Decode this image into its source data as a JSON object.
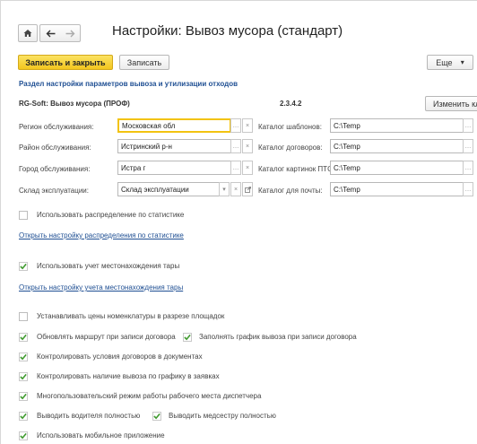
{
  "header": {
    "title": "Настройки: Вывоз мусора (стандарт)"
  },
  "icons": {
    "home": "home-icon",
    "back": "arrow-left-icon",
    "forward": "arrow-right-icon",
    "clear": "×",
    "select": "…",
    "dropdown": "▾",
    "open": "open-icon",
    "check": "checkmark-icon"
  },
  "toolbar": {
    "save_close_label": "Записать и закрыть",
    "save_label": "Записать",
    "more_label": "Еще",
    "more_arrow": "▾"
  },
  "section": {
    "title": "Раздел настройки параметров вывоза и утилизации отходов"
  },
  "product": {
    "name": "RG-Soft: Вывоз мусора (ПРОФ)",
    "version": "2.3.4.2",
    "change_key_label": "Изменить ключ"
  },
  "fields_left": [
    {
      "label": "Регион обслуживания:",
      "value": "Московская обл"
    },
    {
      "label": "Район обслуживания:",
      "value": "Истринский р-н"
    },
    {
      "label": "Город обслуживания:",
      "value": "Истра г"
    },
    {
      "label": "Склад  эксплуатации:",
      "value": "Склад эксплуатации"
    }
  ],
  "fields_right": [
    {
      "label": "Каталог шаблонов:",
      "value": "C:\\Temp"
    },
    {
      "label": "Каталог договоров:",
      "value": "C:\\Temp"
    },
    {
      "label": "Каталог картинок ПТС:",
      "value": "C:\\Temp"
    },
    {
      "label": "Каталог для почты:",
      "value": "C:\\Temp"
    }
  ],
  "options": {
    "use_stats_distribution": {
      "label": "Использовать распределение по статистике",
      "checked": false
    },
    "open_stats_link": "Открыть настройку распределения по статистике",
    "use_container_location": {
      "label": "Использовать учет местонахождения тары",
      "checked": true
    },
    "open_location_link": "Открыть настройку учета местонахождения тары",
    "set_prices_by_site": {
      "label": "Устанавливать цены номенклатуры в разрезе площадок",
      "checked": false
    },
    "update_route": {
      "label": "Обновлять маршрут при записи договора",
      "checked": true
    },
    "fill_schedule": {
      "label": "Заполнять график вывоза при записи договора",
      "checked": true
    },
    "control_contract_terms": {
      "label": "Контролировать условия договоров в документах",
      "checked": true
    },
    "control_schedule": {
      "label": "Контролировать наличие вывоза по графику в заявках",
      "checked": true
    },
    "multiuser_dispatcher": {
      "label": "Многопользовательский режим работы рабочего места диспетчера",
      "checked": true
    },
    "show_driver_full": {
      "label": "Выводить водителя полностью",
      "checked": true
    },
    "show_nurse_full": {
      "label": "Выводить медсестру полностью",
      "checked": true
    },
    "use_mobile_app": {
      "label": "Использовать мобильное приложение",
      "checked": true
    }
  },
  "colors": {
    "accent_yellow": "#f3c61e",
    "link_blue": "#1f4f93",
    "check_green": "#3f9a2e"
  }
}
